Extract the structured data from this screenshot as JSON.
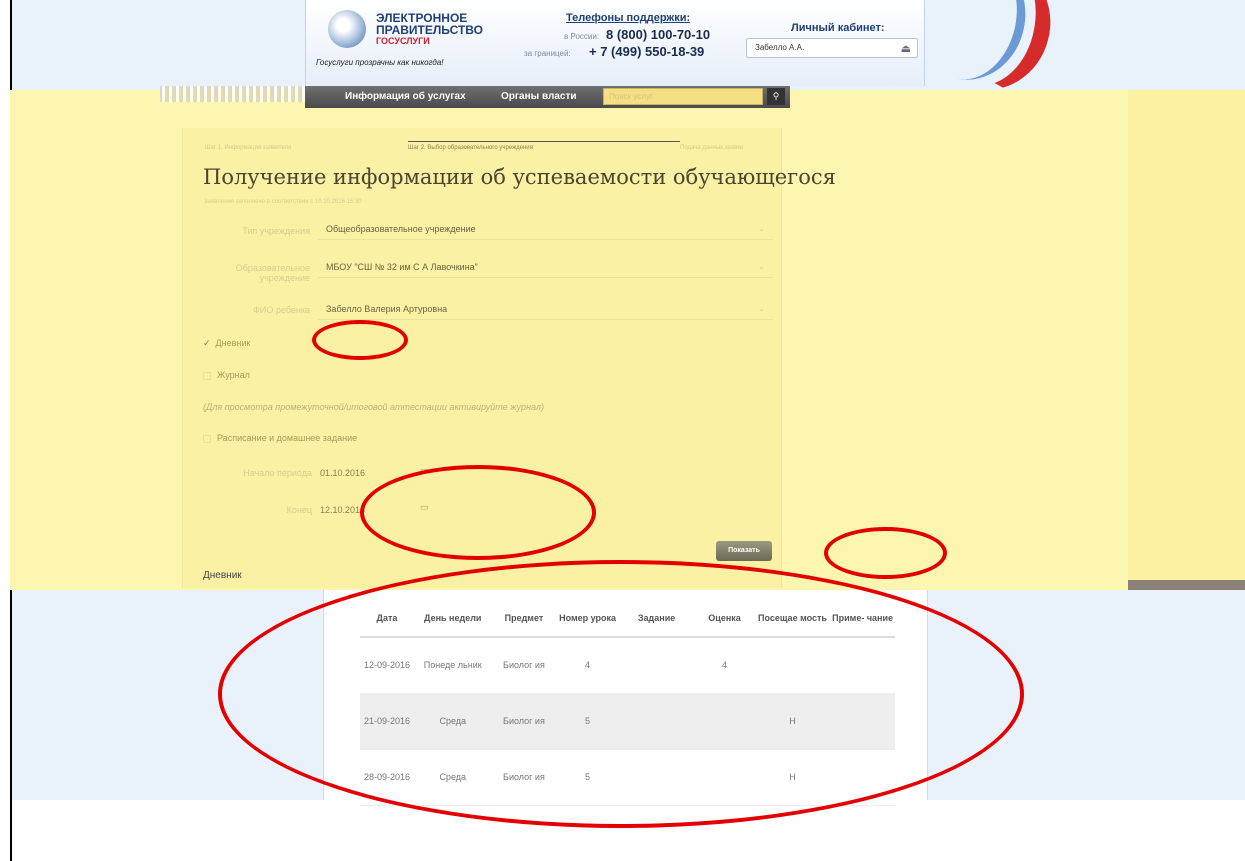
{
  "header": {
    "logo_line1": "ЭЛЕКТРОННОЕ",
    "logo_line2": "ПРАВИТЕЛЬСТВО",
    "logo_line3": "ГОСУСЛУГИ",
    "slogan": "Госуслуги прозрачны как никогда!",
    "phones_title": "Телефоны поддержки:",
    "phone_ru_label": "в России:",
    "phone_ru": "8 (800) 100-70-10",
    "phone_abroad_label": "за границей:",
    "phone_abroad": "+ 7 (499) 550-18-39",
    "cabinet_title": "Личный кабинет:",
    "cabinet_user": "Забелло А.А."
  },
  "nav": {
    "items": [
      "Информация об услугах",
      "Органы власти"
    ],
    "search_placeholder": "Поиск услуг"
  },
  "steps": [
    "Шаг 1. Информация заявителя",
    "Шаг 2. Выбор образовательного учреждения",
    "Подача данных заявки"
  ],
  "page": {
    "title": "Получение информации об успеваемости обучающегося",
    "subhint": "Заявление заполнено в соответствии с 10.10.2016 15:30"
  },
  "form": {
    "institution_type_label": "Тип учреждения",
    "institution_type_value": "Общеобразовательное учреждение",
    "institution_label": "Образовательное учреждение",
    "institution_value": "МБОУ \"СШ № 32 им С А Лавочкина\"",
    "child_label": "ФИО ребенка",
    "child_value": "Забелло Валерия Артуровна",
    "opt_diary": "Дневник",
    "opt_journal": "Журнал",
    "note": "(Для просмотра промежуточной/итоговой аттестации активируйте журнал)",
    "opt_schedule": "Расписание и домашнее задание",
    "date_from_label": "Начало периода",
    "date_from": "01.10.2016",
    "date_to_label": "Конец",
    "date_to": "12.10.2016",
    "show_button": "Показать",
    "diary_heading": "Дневник"
  },
  "table": {
    "headers": [
      "Дата",
      "День недели",
      "Предмет",
      "Номер урока",
      "Задание",
      "Оценка",
      "Посещае мость",
      "Приме- чание"
    ],
    "rows": [
      [
        "12-09-2016",
        "Понеде льник",
        "Биолог ия",
        "4",
        "",
        "4",
        "",
        ""
      ],
      [
        "21-09-2016",
        "Среда",
        "Биолог ия",
        "5",
        "",
        "",
        "Н",
        ""
      ],
      [
        "28-09-2016",
        "Среда",
        "Биолог ия",
        "5",
        "",
        "",
        "Н",
        ""
      ]
    ]
  },
  "colors": {
    "annotation": "#e30000",
    "overlay_yellow": "#fdf6b0",
    "nav_bg": "#4a4a4a"
  }
}
